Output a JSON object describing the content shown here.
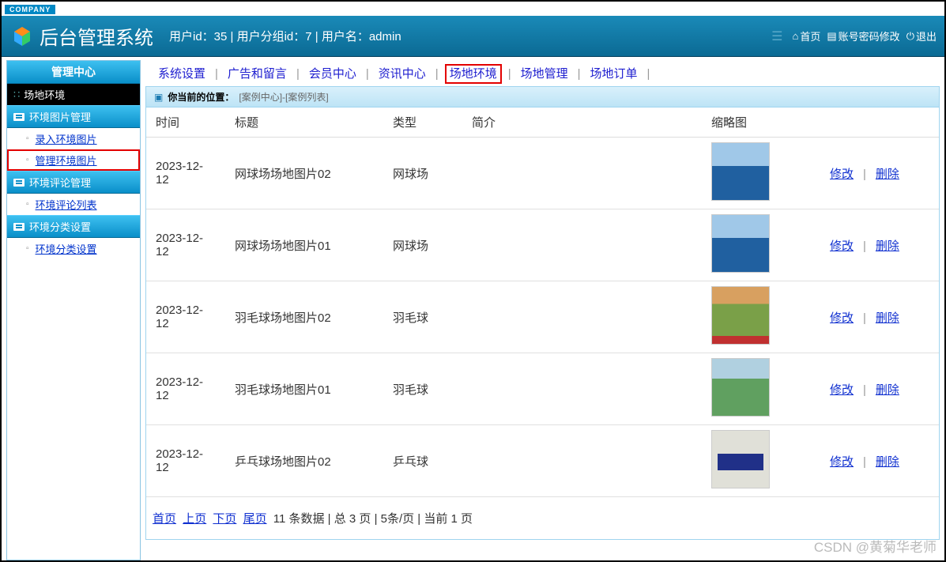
{
  "badge": "COMPANY",
  "app_title": "后台管理系统",
  "user_info": "用户id：35 | 用户分组id：7 | 用户名：admin",
  "header_links": {
    "home": "首页",
    "account": "账号密码修改",
    "logout": "退出"
  },
  "sidebar": {
    "header": "管理中心",
    "section": "场地环境",
    "groups": [
      {
        "title": "环境图片管理",
        "items": [
          {
            "label": "录入环境图片",
            "highlighted": false
          },
          {
            "label": "管理环境图片",
            "highlighted": true
          }
        ]
      },
      {
        "title": "环境评论管理",
        "items": [
          {
            "label": "环境评论列表",
            "highlighted": false
          }
        ]
      },
      {
        "title": "环境分类设置",
        "items": [
          {
            "label": "环境分类设置",
            "highlighted": false
          }
        ]
      }
    ]
  },
  "topnav": [
    {
      "label": "系统设置",
      "active": false
    },
    {
      "label": "广告和留言",
      "active": false
    },
    {
      "label": "会员中心",
      "active": false
    },
    {
      "label": "资讯中心",
      "active": false
    },
    {
      "label": "场地环境",
      "active": true
    },
    {
      "label": "场地管理",
      "active": false
    },
    {
      "label": "场地订单",
      "active": false
    }
  ],
  "breadcrumb": {
    "label": "你当前的位置：",
    "path": "[案例中心]-[案例列表]"
  },
  "table": {
    "headers": {
      "time": "时间",
      "title": "标题",
      "type": "类型",
      "intro": "简介",
      "thumb": "缩略图"
    },
    "actions": {
      "edit": "修改",
      "delete": "删除"
    },
    "rows": [
      {
        "time": "2023-12-12",
        "title": "网球场场地图片02",
        "type": "网球场",
        "intro": "",
        "thumb_class": "court"
      },
      {
        "time": "2023-12-12",
        "title": "网球场场地图片01",
        "type": "网球场",
        "intro": "",
        "thumb_class": "court"
      },
      {
        "time": "2023-12-12",
        "title": "羽毛球场地图片02",
        "type": "羽毛球",
        "intro": "",
        "thumb_class": "gym"
      },
      {
        "time": "2023-12-12",
        "title": "羽毛球场地图片01",
        "type": "羽毛球",
        "intro": "",
        "thumb_class": "outdoor"
      },
      {
        "time": "2023-12-12",
        "title": "乒乓球场地图片02",
        "type": "乒乓球",
        "intro": "",
        "thumb_class": "pingpong"
      }
    ]
  },
  "pager": {
    "first": "首页",
    "prev": "上页",
    "next": "下页",
    "last": "尾页",
    "info": "11 条数据 | 总 3 页 | 5条/页 | 当前 1 页"
  },
  "watermark": "CSDN @黄菊华老师"
}
